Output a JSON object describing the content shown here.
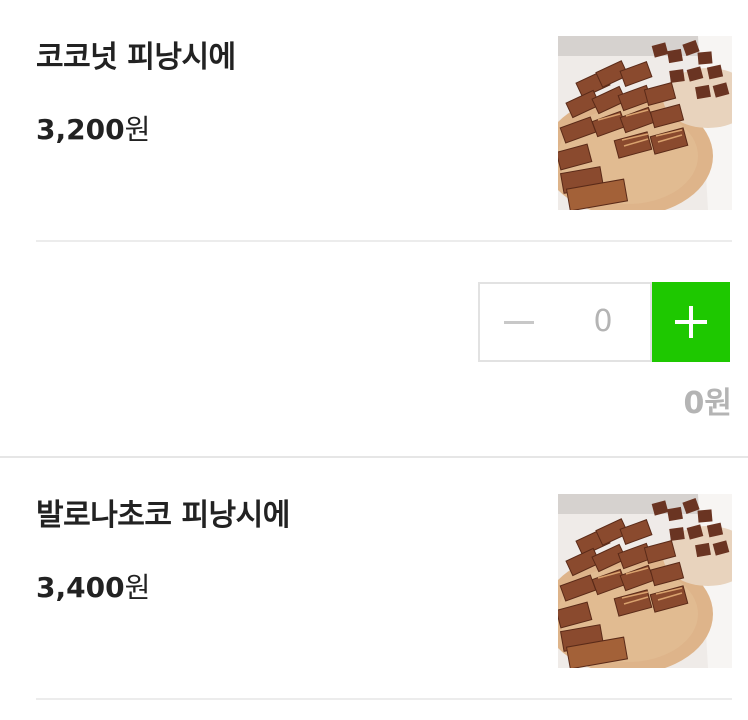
{
  "products": [
    {
      "name": "코코넛 피낭시에",
      "price_amount": "3,200",
      "price_unit": "원",
      "image_subject": "financier-cakes-on-wooden-board"
    },
    {
      "name": "발로나초코 피낭시에",
      "price_amount": "3,400",
      "price_unit": "원",
      "image_subject": "financier-cakes-on-wooden-board"
    }
  ],
  "quantity_selector": {
    "minus_icon": "minus-icon",
    "value": "0",
    "plus_icon": "plus-icon",
    "subtotal": "0원"
  },
  "colors": {
    "accent_green": "#1ec800",
    "text_primary": "#222222",
    "text_muted": "#b4b4b4",
    "divider": "#ececec"
  }
}
